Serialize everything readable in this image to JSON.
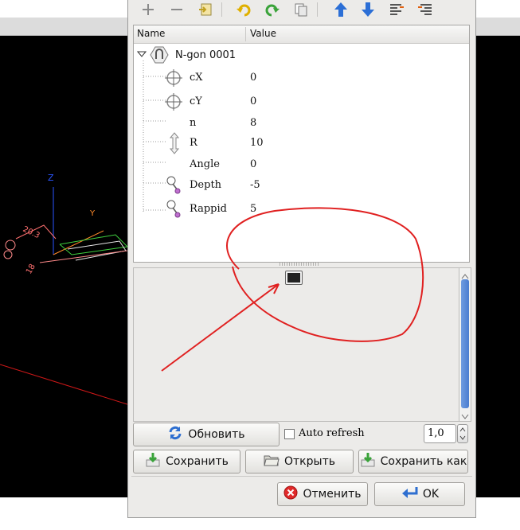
{
  "toolbar": {
    "buttons": [
      "add-icon",
      "remove-icon",
      "import-icon",
      "undo-icon",
      "redo-icon",
      "copy-icon",
      "move-up-icon",
      "move-down-icon",
      "align-left-icon",
      "align-right-icon"
    ]
  },
  "tree": {
    "columns": {
      "name": "Name",
      "value": "Value"
    },
    "root": {
      "label": "N-gon 0001"
    },
    "rows": [
      {
        "label": "cX",
        "value": "0",
        "icon": "crosshair-icon"
      },
      {
        "label": "cY",
        "value": "0",
        "icon": "crosshair-icon"
      },
      {
        "label": "n",
        "value": "8",
        "icon": ""
      },
      {
        "label": "R",
        "value": "10",
        "icon": "double-arrow-icon"
      },
      {
        "label": "Angle",
        "value": "0",
        "icon": ""
      },
      {
        "label": "Depth",
        "value": "-5",
        "icon": "probe-icon"
      },
      {
        "label": "Rappid",
        "value": "5",
        "icon": "probe-icon"
      }
    ]
  },
  "controls": {
    "refresh_label": "Обновить",
    "auto_refresh_label": "Auto refresh",
    "auto_refresh_checked": false,
    "scale_value": "1,0"
  },
  "actions": {
    "save_label": "Сохранить",
    "open_label": "Открыть",
    "save_as_label": "Сохранить как",
    "cancel_label": "Отменить",
    "ok_label": "OK"
  },
  "annotation": {
    "color": "#e02020"
  },
  "viewport": {
    "axis_labels": {
      "z": "Z",
      "y": "Y"
    },
    "dimension_labels": [
      "20.3",
      "18"
    ]
  }
}
